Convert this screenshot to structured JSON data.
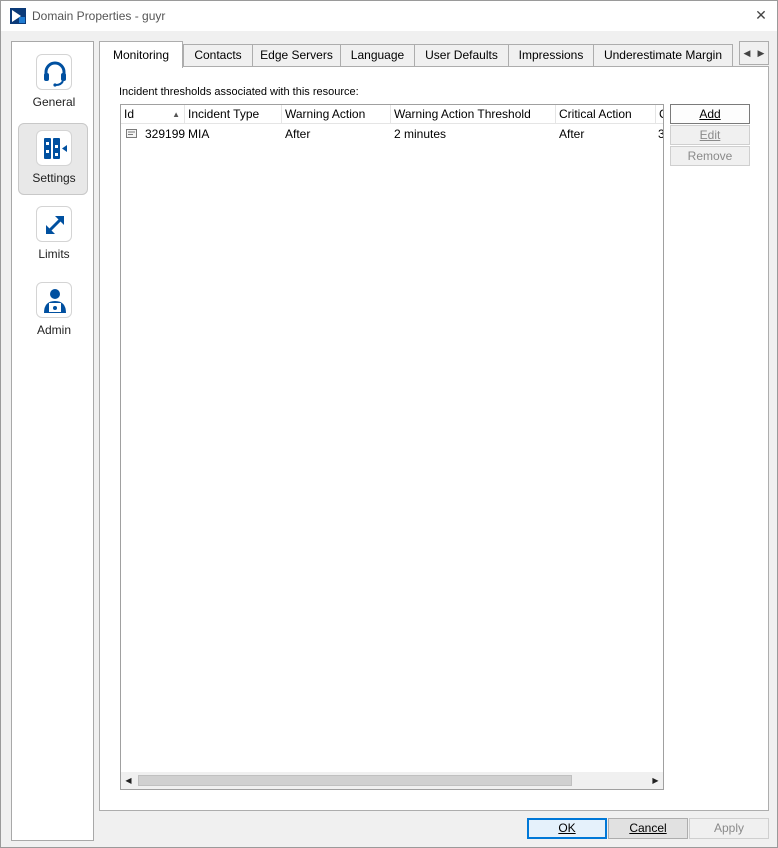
{
  "window": {
    "title": "Domain Properties - guyr",
    "close_glyph": "✕"
  },
  "sidebar": {
    "items": [
      {
        "label": "General",
        "icon": "headset-icon"
      },
      {
        "label": "Settings",
        "icon": "settings-sliders-icon",
        "selected": true
      },
      {
        "label": "Limits",
        "icon": "diagonal-arrows-icon"
      },
      {
        "label": "Admin",
        "icon": "admin-user-icon"
      }
    ]
  },
  "tabs": {
    "items": [
      {
        "label": "Monitoring",
        "active": true
      },
      {
        "label": "Contacts"
      },
      {
        "label": "Edge Servers"
      },
      {
        "label": "Language"
      },
      {
        "label": "User Defaults"
      },
      {
        "label": "Impressions"
      },
      {
        "label": "Underestimate Margin"
      }
    ],
    "scroll_left": "◀",
    "scroll_right": "▶"
  },
  "monitoring": {
    "section_label": "Incident thresholds associated with this resource:",
    "columns": [
      "Id",
      "Incident Type",
      "Warning Action",
      "Warning Action Threshold",
      "Critical Action",
      "C"
    ],
    "sort_indicator": "▲",
    "rows": [
      {
        "id": "329199",
        "incident_type": "MIA",
        "warning_action": "After",
        "warning_threshold": "2 minutes",
        "critical_action": "After",
        "critical_threshold": "3"
      }
    ],
    "scroll_left": "◀",
    "scroll_right": "▶",
    "buttons": {
      "add": "Add",
      "edit": "Edit",
      "remove": "Remove"
    }
  },
  "footer": {
    "ok": "OK",
    "cancel": "Cancel",
    "apply": "Apply"
  },
  "colors": {
    "accent": "#0050a0",
    "default_button_border": "#0078d7"
  }
}
